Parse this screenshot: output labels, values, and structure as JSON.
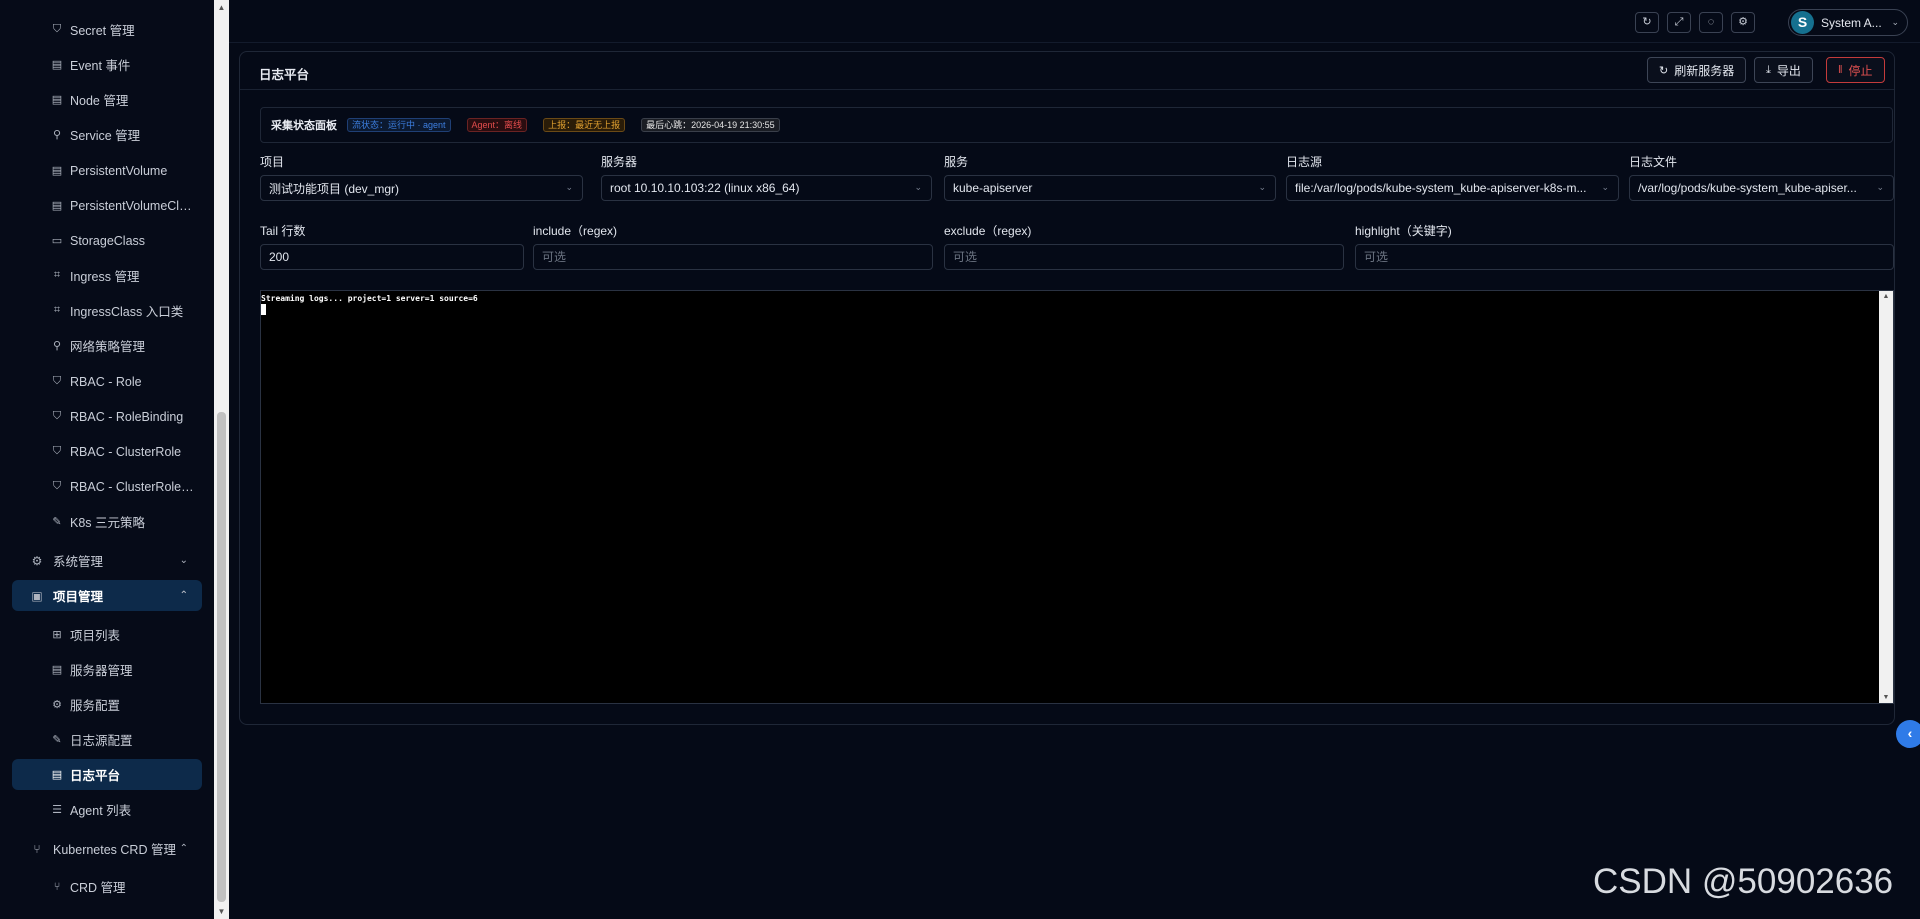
{
  "sidebar": {
    "items": [
      {
        "label": "Secret 管理",
        "icon": "shield-icon"
      },
      {
        "label": "Event 事件",
        "icon": "file-icon"
      },
      {
        "label": "Node 管理",
        "icon": "file-icon"
      },
      {
        "label": "Service 管理",
        "icon": "network-icon"
      },
      {
        "label": "PersistentVolume",
        "icon": "file-icon"
      },
      {
        "label": "PersistentVolumeClai...",
        "icon": "file-icon"
      },
      {
        "label": "StorageClass",
        "icon": "folder-icon"
      },
      {
        "label": "Ingress 管理",
        "icon": "ingress-icon"
      },
      {
        "label": "IngressClass 入口类",
        "icon": "ingress-icon"
      },
      {
        "label": "网络策略管理",
        "icon": "network-icon"
      },
      {
        "label": "RBAC - Role",
        "icon": "shield-icon"
      },
      {
        "label": "RBAC - RoleBinding",
        "icon": "shield-icon"
      },
      {
        "label": "RBAC - ClusterRole",
        "icon": "shield-icon"
      },
      {
        "label": "RBAC - ClusterRoleBi...",
        "icon": "shield-icon"
      },
      {
        "label": "K8s 三元策略",
        "icon": "doc-edit-icon"
      }
    ],
    "group_system": {
      "label": "系统管理",
      "icon": "gear-icon"
    },
    "group_project": {
      "label": "项目管理",
      "icon": "project-icon"
    },
    "project_items": [
      {
        "label": "项目列表",
        "icon": "grid-icon"
      },
      {
        "label": "服务器管理",
        "icon": "file-icon"
      },
      {
        "label": "服务配置",
        "icon": "gear-icon"
      },
      {
        "label": "日志源配置",
        "icon": "doc-edit-icon"
      },
      {
        "label": "日志平台",
        "icon": "doc-icon"
      },
      {
        "label": "Agent 列表",
        "icon": "list-icon"
      }
    ],
    "group_crd": {
      "label": "Kubernetes CRD 管理",
      "icon": "branch-icon"
    },
    "crd_items": [
      {
        "label": "CRD 管理",
        "icon": "branch-icon"
      }
    ]
  },
  "topbar": {
    "user_initial": "S",
    "user_name": "System A...",
    "icons": [
      "refresh-icon",
      "fullscreen-icon",
      "bulb-icon",
      "gear-icon"
    ]
  },
  "card": {
    "title": "日志平台",
    "refresh_label": "刷新服务器",
    "export_label": "导出",
    "stop_label": "停止"
  },
  "status_panel": {
    "title": "采集状态面板",
    "tag_stream": "流状态：运行中 · agent",
    "tag_agent": "Agent：离线",
    "tag_report": "上报：最近无上报",
    "tag_heartbeat": "最后心跳：2026-04-19 21:30:55"
  },
  "filters": {
    "project": {
      "label": "项目",
      "value": "测试功能项目 (dev_mgr)"
    },
    "server": {
      "label": "服务器",
      "value": "root 10.10.10.103:22 (linux x86_64)"
    },
    "service": {
      "label": "服务",
      "value": "kube-apiserver"
    },
    "source": {
      "label": "日志源",
      "value": "file:/var/log/pods/kube-system_kube-apiserver-k8s-m..."
    },
    "file": {
      "label": "日志文件",
      "value": "/var/log/pods/kube-system_kube-apiser..."
    },
    "tail": {
      "label": "Tail 行数",
      "value": "200"
    },
    "include": {
      "label": "include（regex)",
      "placeholder": "可选"
    },
    "exclude": {
      "label": "exclude（regex)",
      "placeholder": "可选"
    },
    "highlight": {
      "label": "highlight（关键字)",
      "placeholder": "可选"
    }
  },
  "terminal": {
    "line": "Streaming logs... project=1 server=1 source=6"
  },
  "watermark": "CSDN @50902636"
}
